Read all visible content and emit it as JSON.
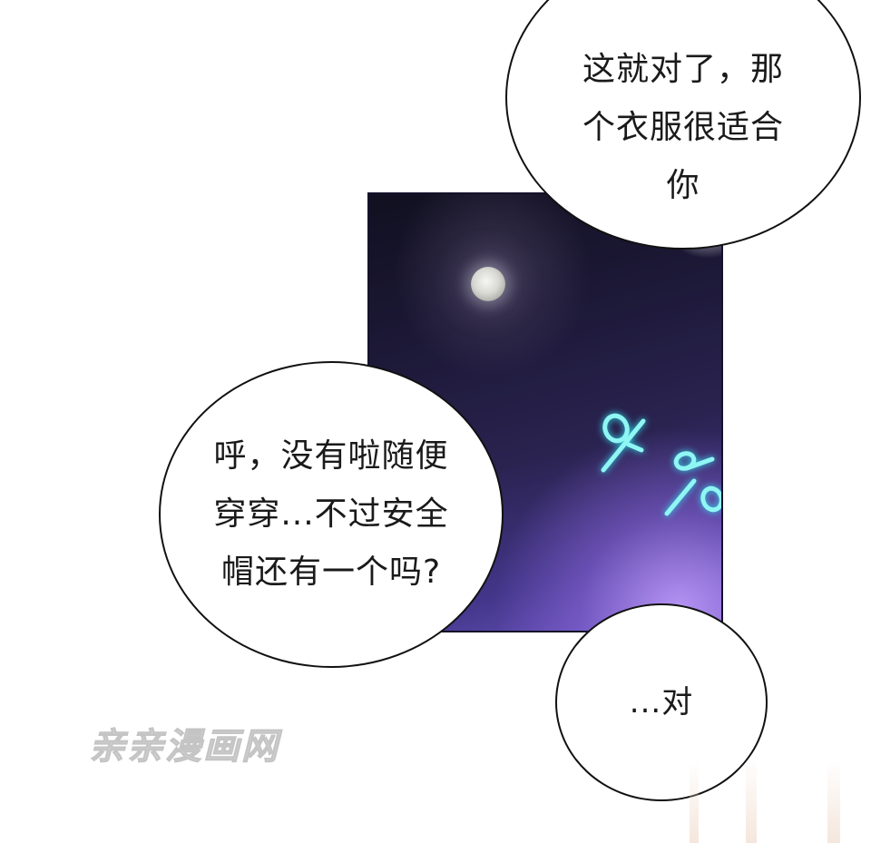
{
  "panel": {
    "sky_colors": [
      "#111020",
      "#2a2350",
      "#6b55c0"
    ],
    "moon_color": "#e5e5e0",
    "sfx_color": "#7ff3f2"
  },
  "bubbles": {
    "top_text": "这就对了，那\n个衣服很适合\n你",
    "left_text": "呼，没有啦随便\n穿穿...不过安全\n帽还有一个吗?",
    "small_text": "...对"
  },
  "watermark": {
    "text": "亲亲漫画网"
  },
  "icons": {
    "moon": "moon-icon",
    "sfx": "sound-effect-glyphs"
  }
}
